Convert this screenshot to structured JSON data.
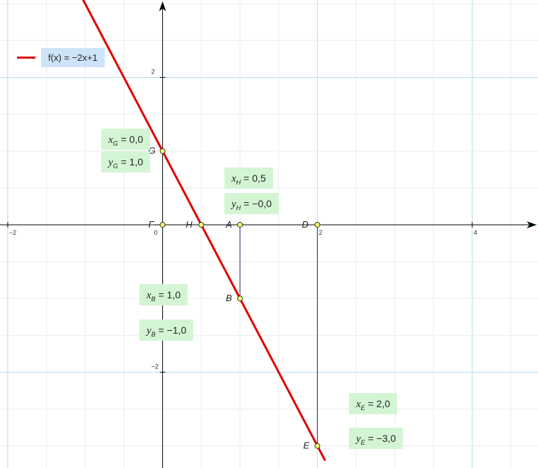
{
  "chart_data": {
    "type": "line",
    "function_label": "f(x) = −2x+1",
    "series": [
      {
        "name": "f(x) = −2x+1",
        "x": [
          -1.1,
          2.1
        ],
        "y": [
          3.2,
          -3.2
        ],
        "color": "#e00000"
      }
    ],
    "xlim": [
      -2.1,
      4.85
    ],
    "ylim": [
      -3.3,
      3.05
    ],
    "grid": true,
    "legend_position": "top-left",
    "x_ticks": [
      {
        "value": -2,
        "label": "−2"
      },
      {
        "value": 0,
        "label": "0"
      },
      {
        "value": 2,
        "label": "2"
      },
      {
        "value": 4,
        "label": "4"
      }
    ],
    "y_ticks": [
      {
        "value": 2,
        "label": "2"
      },
      {
        "value": -2,
        "label": "−2"
      }
    ],
    "points": [
      {
        "name": "G",
        "x": 0,
        "y": 1
      },
      {
        "name": "F",
        "x": 0,
        "y": 0
      },
      {
        "name": "H",
        "x": 0.5,
        "y": 0
      },
      {
        "name": "A",
        "x": 1,
        "y": 0
      },
      {
        "name": "D",
        "x": 2,
        "y": 0
      },
      {
        "name": "B",
        "x": 1,
        "y": -1
      },
      {
        "name": "E",
        "x": 2,
        "y": -3
      }
    ],
    "segments": [
      [
        "A",
        "B"
      ],
      [
        "D",
        "E"
      ]
    ],
    "annotations": [
      {
        "var": "x",
        "sub": "G",
        "value": "0,0"
      },
      {
        "var": "y",
        "sub": "G",
        "value": "1,0"
      },
      {
        "var": "x",
        "sub": "H",
        "value": "0,5"
      },
      {
        "var": "y",
        "sub": "H",
        "value": "−0,0"
      },
      {
        "var": "x",
        "sub": "B",
        "value": "1,0"
      },
      {
        "var": "y",
        "sub": "B",
        "value": "−1,0"
      },
      {
        "var": "x",
        "sub": "E",
        "value": "2,0"
      },
      {
        "var": "y",
        "sub": "E",
        "value": "−3,0"
      }
    ]
  }
}
